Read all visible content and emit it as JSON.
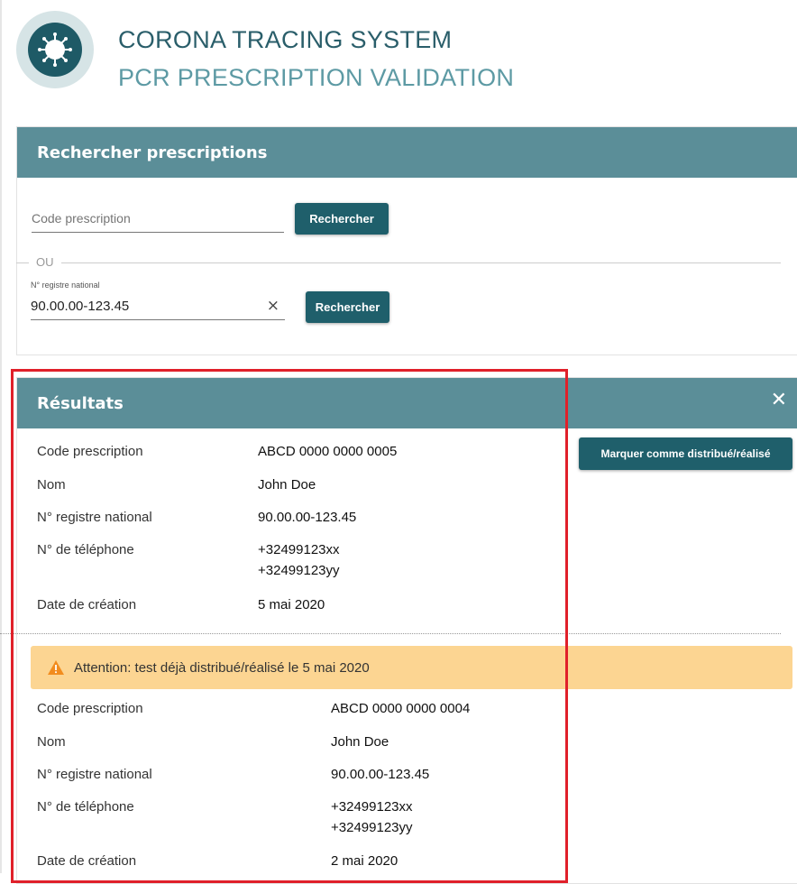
{
  "header": {
    "title": "CORONA TRACING SYSTEM",
    "subtitle": "PCR PRESCRIPTION VALIDATION",
    "logo_icon": "virus-icon",
    "colors": {
      "primary": "#1f5f6b",
      "panel_header": "#5b8e98",
      "warning_bg": "#fcd592",
      "highlight": "#e0202a"
    }
  },
  "search": {
    "title": "Rechercher prescriptions",
    "code_placeholder": "Code prescription",
    "code_value": "",
    "search_label": "Rechercher",
    "or_label": "OU",
    "nrn_label": "N° registre national",
    "nrn_value": "90.00.00-123.45",
    "clear_symbol": "×",
    "search_label_2": "Rechercher"
  },
  "results": {
    "title": "Résultats",
    "close_symbol": "✕",
    "mark_button": "Marquer comme distribué/réalisé",
    "items": [
      {
        "labels": {
          "code": "Code prescription",
          "name": "Nom",
          "nrn": "N° registre national",
          "phone": "N° de téléphone",
          "date": "Date de création"
        },
        "code": "ABCD 0000 0000 0005",
        "name": "John Doe",
        "nrn": "90.00.00-123.45",
        "phone1": "+32499123xx",
        "phone2": "+32499123yy",
        "date": "5 mai 2020"
      },
      {
        "warning": "Attention: test déjà distribué/réalisé le 5 mai 2020",
        "labels": {
          "code": "Code prescription",
          "name": "Nom",
          "nrn": "N° registre national",
          "phone": "N° de téléphone",
          "date": "Date de création"
        },
        "code": "ABCD 0000 0000 0004",
        "name": "John Doe",
        "nrn": "90.00.00-123.45",
        "phone1": "+32499123xx",
        "phone2": "+32499123yy",
        "date": "2 mai 2020"
      }
    ]
  }
}
